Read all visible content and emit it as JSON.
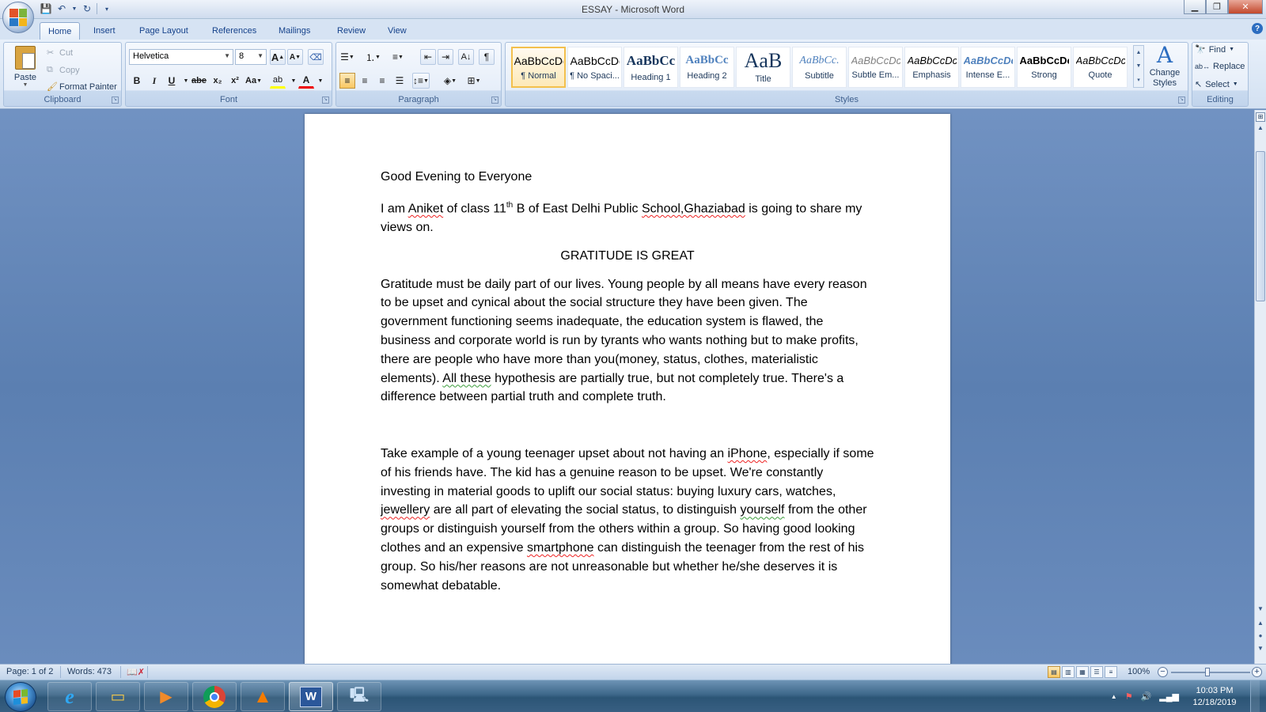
{
  "window": {
    "title": "ESSAY - Microsoft Word"
  },
  "tabs": [
    {
      "label": "Home",
      "active": true
    },
    {
      "label": "Insert"
    },
    {
      "label": "Page Layout"
    },
    {
      "label": "References"
    },
    {
      "label": "Mailings"
    },
    {
      "label": "Review"
    },
    {
      "label": "View"
    }
  ],
  "clipboard": {
    "paste": "Paste",
    "cut": "Cut",
    "copy": "Copy",
    "format_painter": "Format Painter",
    "label": "Clipboard"
  },
  "font": {
    "name": "Helvetica",
    "size": "8",
    "label": "Font",
    "bold": "B",
    "italic": "I",
    "underline": "U",
    "strike": "abe",
    "subscript": "x₂",
    "superscript": "x²",
    "change_case": "Aa",
    "grow": "A",
    "shrink": "A"
  },
  "paragraph": {
    "label": "Paragraph"
  },
  "styles": {
    "label": "Styles",
    "items": [
      {
        "sample": "AaBbCcDc",
        "name": "¶ Normal",
        "selected": true
      },
      {
        "sample": "AaBbCcDc",
        "name": "¶ No Spaci..."
      },
      {
        "sample": "AaBbCc",
        "name": "Heading 1"
      },
      {
        "sample": "AaBbCc",
        "name": "Heading 2"
      },
      {
        "sample": "AaB",
        "name": "Title"
      },
      {
        "sample": "AaBbCc.",
        "name": "Subtitle"
      },
      {
        "sample": "AaBbCcDc",
        "name": "Subtle Em..."
      },
      {
        "sample": "AaBbCcDc",
        "name": "Emphasis"
      },
      {
        "sample": "AaBbCcDc",
        "name": "Intense E..."
      },
      {
        "sample": "AaBbCcDc",
        "name": "Strong"
      },
      {
        "sample": "AaBbCcDc",
        "name": "Quote"
      }
    ],
    "change_line1": "Change",
    "change_line2": "Styles"
  },
  "editing": {
    "label": "Editing",
    "find": "Find",
    "replace": "Replace",
    "select": "Select"
  },
  "document": {
    "greeting": "Good Evening to Everyone",
    "intro_a": "I am ",
    "intro_name": "Aniket",
    "intro_b": " of class 11",
    "intro_sup": "th",
    "intro_c": " B of East Delhi Public ",
    "intro_school": "School,Ghaziabad",
    "intro_d": " is going to share my views on.",
    "heading": "GRATITUDE IS GREAT",
    "para1_a": "Gratitude must be daily part of our lives. Young people by all means have every reason to be upset and cynical about the social structure they have been given. The government functioning seems inadequate, the education system is flawed, the business and corporate world is run by tyrants who wants nothing but to make profits, there are people who have more than you(money, status, clothes, materialistic elements). ",
    "para1_b": "All these",
    "para1_c": " hypothesis are partially true, but not completely true. There's a difference between partial truth and complete truth.",
    "para2_a": "Take example of a young teenager upset about not having an ",
    "para2_iphone": "iPhone",
    "para2_b": ", especially if some of his friends have. The kid has a genuine reason to be upset. We're constantly investing in material goods to uplift our social status: buying luxury cars, watches, ",
    "para2_jewellery": "jewellery",
    "para2_c": " are all part of elevating the social status, to distinguish ",
    "para2_yourself": "yourself",
    "para2_d": " from the other groups or distinguish yourself from the others within a group. So having good looking clothes and an expensive ",
    "para2_smartphone": "smartphone",
    "para2_e": " can distinguish the teenager from the rest of his group. So his/her reasons are not unreasonable but whether he/she deserves it is somewhat debatable."
  },
  "status": {
    "page": "Page: 1 of 2",
    "words": "Words: 473",
    "zoom": "100%"
  },
  "taskbar": {
    "time": "10:03 PM",
    "date": "12/18/2019"
  }
}
